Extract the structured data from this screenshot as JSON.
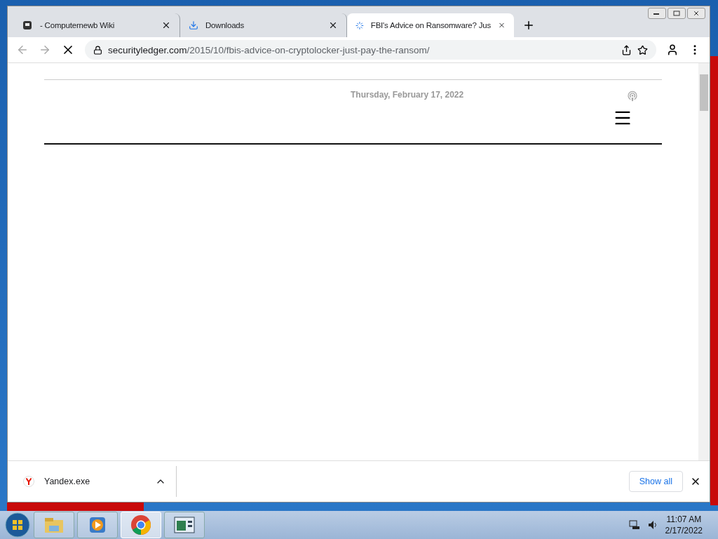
{
  "browser": {
    "tabs": [
      {
        "title": "- Computernewb Wiki",
        "selected": false,
        "loading": false
      },
      {
        "title": "Downloads",
        "selected": false,
        "loading": false
      },
      {
        "title": "FBI's Advice on Ransomware? Jus",
        "selected": true,
        "loading": true
      }
    ],
    "address": {
      "domain": "securityledger.com",
      "path": "/2015/10/fbis-advice-on-cryptolocker-just-pay-the-ransom/"
    },
    "page": {
      "date": "Thursday, February 17, 2022"
    },
    "download_bar": {
      "items": [
        {
          "name": "Yandex.exe"
        }
      ],
      "show_all": "Show all"
    }
  },
  "taskbar": {
    "apps": [
      {
        "kind": "explorer",
        "selected": false
      },
      {
        "kind": "media",
        "selected": false
      },
      {
        "kind": "chrome",
        "selected": true
      },
      {
        "kind": "window",
        "selected": false
      }
    ],
    "clock": {
      "time": "11:07 AM",
      "date": "2/17/2022"
    }
  }
}
